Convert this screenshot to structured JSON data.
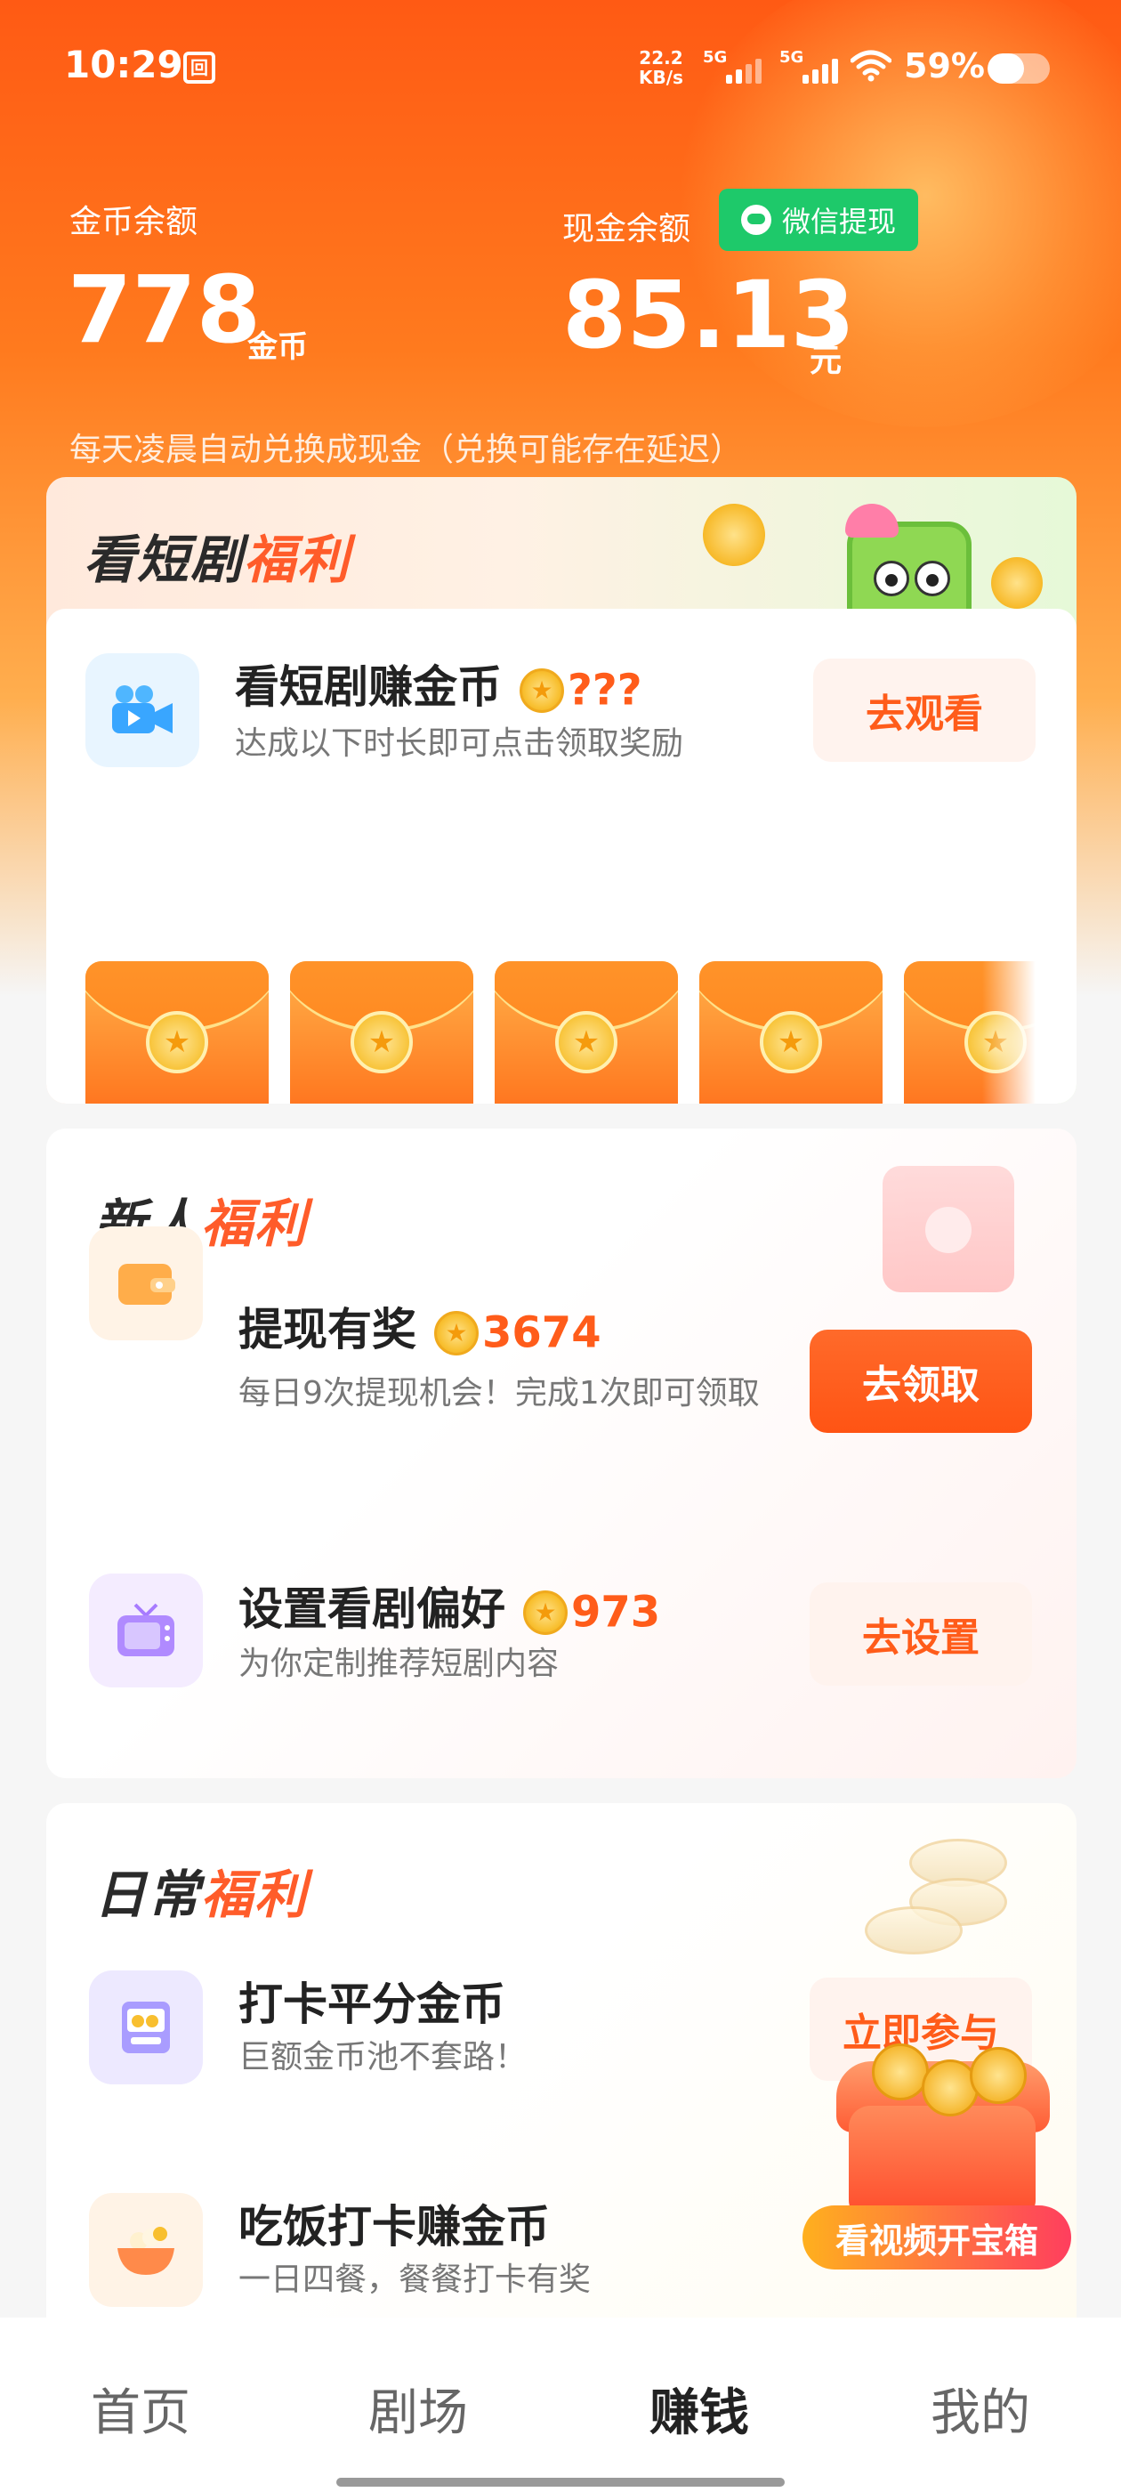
{
  "status_bar": {
    "time": "10:29",
    "notification_icon_glyph": "回",
    "net_speed_value": "22.2",
    "net_speed_unit": "KB/s",
    "sim1_label": "5G",
    "sim2_label": "5G",
    "battery_percent": "59%",
    "battery_level": 0.59
  },
  "balances": {
    "coin_label": "金币余额",
    "coin_value": "778",
    "coin_unit": "金币",
    "cash_label": "现金余额",
    "cash_value": "85.13",
    "cash_unit": "元",
    "wechat_withdraw_label": "微信提现",
    "note": "每天凌晨自动兑换成现金（兑换可能存在延迟）"
  },
  "drama_section": {
    "title_main": "看短剧",
    "title_accent": "福利",
    "task_title": "看短剧赚金币",
    "task_reward": "???",
    "task_desc": "达成以下时长即可点击领取奖励",
    "button_label": "去观看",
    "envelopes": [
      "???",
      "???",
      "???",
      "???",
      "???"
    ]
  },
  "newbie_section": {
    "title_main": "新人",
    "title_accent": "福利",
    "tasks": [
      {
        "title": "提现有奖",
        "reward": "3674",
        "desc": "每日9次提现机会！完成1次即可领取",
        "button": "去领取"
      },
      {
        "title": "设置看剧偏好",
        "reward": "973",
        "desc": "为你定制推荐短剧内容",
        "button": "去设置"
      }
    ]
  },
  "daily_section": {
    "title_main": "日常",
    "title_accent": "福利",
    "tasks": [
      {
        "title": "打卡平分金币",
        "desc": "巨额金币池不套路！",
        "button": "立即参与"
      },
      {
        "title": "吃饭打卡赚金币",
        "desc": "一日四餐，餐餐打卡有奖"
      }
    ]
  },
  "floating_chest": {
    "label": "看视频开宝箱"
  },
  "bottom_nav": [
    "首页",
    "剧场",
    "赚钱",
    "我的"
  ],
  "bottom_nav_active": "赚钱",
  "colors": {
    "accent": "#ff5c1a",
    "wechat_green": "#1ec96a"
  }
}
